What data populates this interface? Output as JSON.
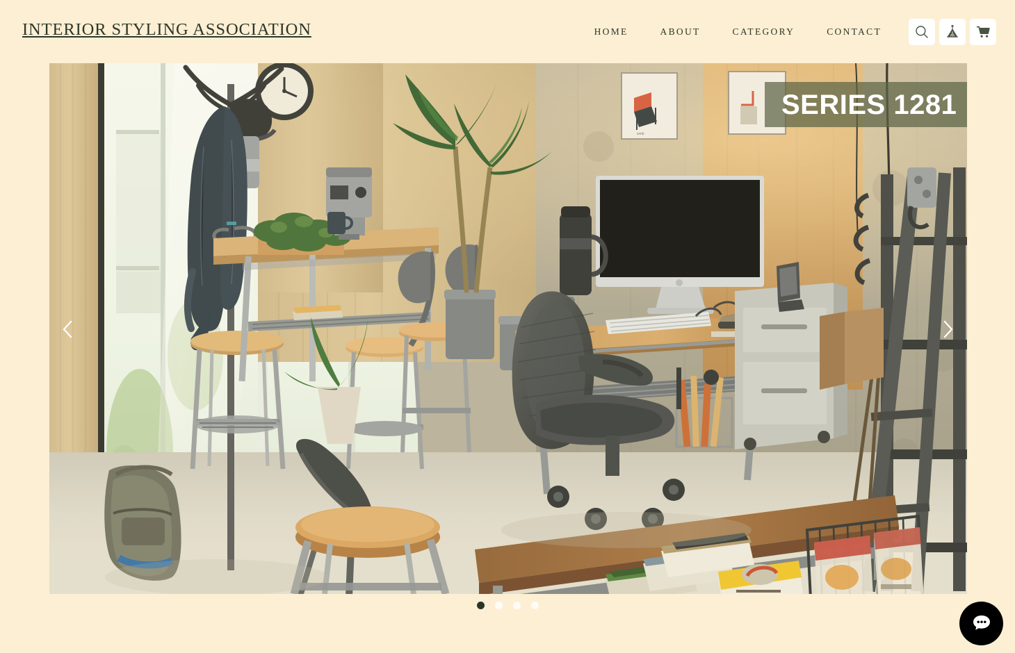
{
  "site": {
    "brand": "INTERIOR STYLING ASSOCIATION",
    "background_color": "#FCEFD3",
    "text_color": "#2D3629"
  },
  "header": {
    "nav": [
      {
        "label": "HOME",
        "name": "nav-home"
      },
      {
        "label": "ABOUT",
        "name": "nav-about"
      },
      {
        "label": "CATEGORY",
        "name": "nav-category"
      },
      {
        "label": "CONTACT",
        "name": "nav-contact"
      }
    ],
    "icons": [
      {
        "name": "search-icon",
        "label": "Search"
      },
      {
        "name": "tent-icon",
        "label": "Tent"
      },
      {
        "name": "cart-icon",
        "label": "Cart"
      }
    ]
  },
  "hero": {
    "caption": "SERIES 1281",
    "caption_band_color": "#5C6446",
    "caption_text_color": "#FFFFFF",
    "alt": "Modern industrial interior workspace with wooden desk, iMac, Aeron office chair, high table with stools, coat rack, potted plants and large windows",
    "prev_label": "‹",
    "next_label": "›"
  },
  "carousel": {
    "slide_count": 4,
    "active_index": 0,
    "dots": [
      {
        "label": "Slide 1"
      },
      {
        "label": "Slide 2"
      },
      {
        "label": "Slide 3"
      },
      {
        "label": "Slide 4"
      }
    ],
    "active_dot_color": "#2B3429",
    "inactive_dot_color": "#FFFFFF"
  },
  "chat": {
    "name": "chat-widget-button",
    "label": "Chat",
    "color": "#000000"
  }
}
